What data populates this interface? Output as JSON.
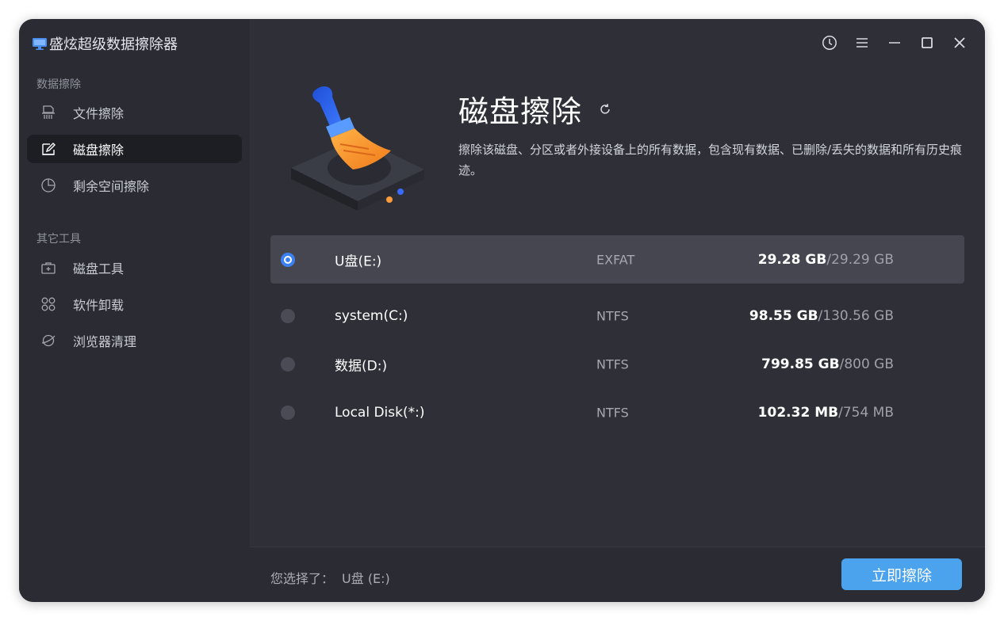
{
  "app": {
    "title": "盛炫超级数据擦除器"
  },
  "sidebar": {
    "sections": [
      {
        "label": "数据擦除",
        "items": [
          {
            "label": "文件擦除",
            "icon": "file-shred-icon",
            "active": false
          },
          {
            "label": "磁盘擦除",
            "icon": "disk-erase-icon",
            "active": true
          },
          {
            "label": "剩余空间擦除",
            "icon": "pie-chart-icon",
            "active": false
          }
        ]
      },
      {
        "label": "其它工具",
        "items": [
          {
            "label": "磁盘工具",
            "icon": "toolbox-icon",
            "active": false
          },
          {
            "label": "软件卸载",
            "icon": "apps-grid-icon",
            "active": false
          },
          {
            "label": "浏览器清理",
            "icon": "browser-clean-icon",
            "active": false
          }
        ]
      }
    ]
  },
  "window_controls": [
    "history-icon",
    "menu-icon",
    "minimize-icon",
    "maximize-icon",
    "close-icon"
  ],
  "hero": {
    "title": "磁盘擦除",
    "description": "擦除该磁盘、分区或者外接设备上的所有数据，包含现有数据、已删除/丢失的数据和所有历史痕迹。"
  },
  "disks": [
    {
      "name": "U盘(E:)",
      "fs": "EXFAT",
      "used": "29.28 GB",
      "total": "29.29 GB",
      "selected": true
    },
    {
      "name": "system(C:)",
      "fs": "NTFS",
      "used": "98.55 GB",
      "total": "130.56 GB",
      "selected": false
    },
    {
      "name": "数据(D:)",
      "fs": "NTFS",
      "used": "799.85 GB",
      "total": "800 GB",
      "selected": false
    },
    {
      "name": "Local Disk(*:)",
      "fs": "NTFS",
      "used": "102.32 MB",
      "total": "754 MB",
      "selected": false
    }
  ],
  "footer": {
    "selected_label": "您选择了：",
    "selected_value": "U盘 (E:)",
    "erase_button": "立即擦除"
  },
  "colors": {
    "accent": "#4ba3ee",
    "radio_on": "#3b82f0",
    "background": "#2e2f37",
    "sidebar": "#2b2c33"
  }
}
